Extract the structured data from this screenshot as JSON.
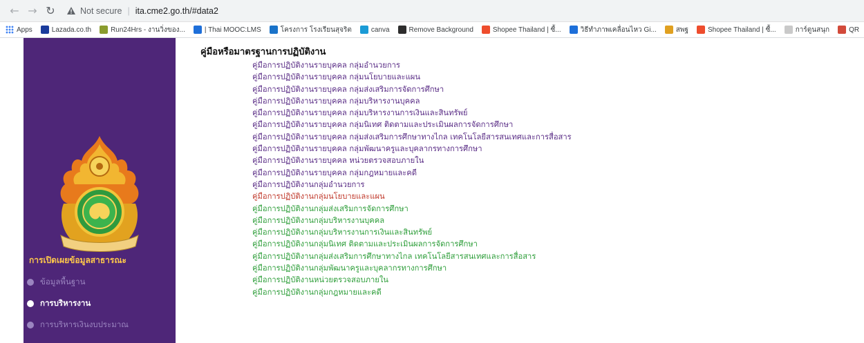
{
  "browser": {
    "security_label": "Not secure",
    "url": "ita.cme2.go.th/#data2",
    "icons": [
      "back-arrow-icon",
      "forward-arrow-icon",
      "reload-icon",
      "warning-triangle-icon"
    ]
  },
  "bookmarks": [
    {
      "label": "Apps",
      "icon": "apps-grid-icon",
      "color": "#4285f4"
    },
    {
      "label": "Lazada.co.th",
      "icon": "lazada-icon",
      "color": "#1a3b9c"
    },
    {
      "label": "Run24Hrs - งานวิ่งของ...",
      "icon": "run-icon",
      "color": "#8a9c2e"
    },
    {
      "label": "| Thai MOOC:LMS",
      "icon": "thaimooc-icon",
      "color": "#1e6fd9"
    },
    {
      "label": "โครงการ โรงเรียนสุจริต",
      "icon": "school-icon",
      "color": "#1a73c9"
    },
    {
      "label": "canva",
      "icon": "canva-icon",
      "color": "#1a9bd6"
    },
    {
      "label": "Remove Background",
      "icon": "removebg-icon",
      "color": "#2d2d2d"
    },
    {
      "label": "Shopee Thailand | ซื้...",
      "icon": "shopee-icon",
      "color": "#ee4d2d"
    },
    {
      "label": "วิธีทำภาพเคลื่อนไหว Gi...",
      "icon": "gif-icon",
      "color": "#1d6fd9"
    },
    {
      "label": "สพฐ",
      "icon": "obec-icon",
      "color": "#e0a020"
    },
    {
      "label": "Shopee Thailand | ซื้...",
      "icon": "shopee-icon",
      "color": "#ee4d2d"
    },
    {
      "label": "การ์ตูนสนุก",
      "icon": "cartoon-icon",
      "color": "#c9c9c9"
    },
    {
      "label": "QR",
      "icon": "qr-icon",
      "color": "#d24a3a"
    }
  ],
  "sidebar": {
    "heading": "การเปิดเผยข้อมูลสาธารณะ",
    "items": [
      {
        "label": "ข้อมูลพื้นฐาน",
        "state": "muted"
      },
      {
        "label": "การบริหารงาน",
        "state": "active"
      },
      {
        "label": "การบริหารเงินงบประมาณ",
        "state": "muted"
      }
    ],
    "colors": {
      "background": "#4e2678",
      "heading": "#ffc94a",
      "muted": "#9b85c0",
      "active": "#ffffff"
    }
  },
  "main": {
    "title": "คู่มือหรือมาตรฐานการปฏิบัติงาน",
    "documents": [
      {
        "label": "คู่มือการปฏิบัติงานรายบุคคล กลุ่มอำนวยการ",
        "color": "purple"
      },
      {
        "label": "คู่มือการปฏิบัติงานรายบุคคล กลุ่มนโยบายและแผน",
        "color": "purple"
      },
      {
        "label": "คู่มือการปฏิบัติงานรายบุคคล กลุ่มส่งเสริมการจัดการศึกษา",
        "color": "purple"
      },
      {
        "label": "คู่มือการปฏิบัติงานรายบุคคล กลุ่มบริหารงานบุคคล",
        "color": "purple"
      },
      {
        "label": "คู่มือการปฏิบัติงานรายบุคคล กลุ่มบริหารงานการเงินและสินทรัพย์",
        "color": "purple"
      },
      {
        "label": "คู่มือการปฏิบัติงานรายบุคคล กลุ่มนิเทศ ติดตามและประเมินผลการจัดการศึกษา",
        "color": "purple"
      },
      {
        "label": "คู่มือการปฏิบัติงานรายบุคคล กลุ่มส่งเสริมการศึกษาทางไกล เทคโนโลยีสารสนเทศและการสื่อสาร",
        "color": "purple"
      },
      {
        "label": "คู่มือการปฏิบัติงานรายบุคคล กลุ่มพัฒนาครูและบุคลากรทางการศึกษา",
        "color": "purple"
      },
      {
        "label": "คู่มือการปฏิบัติงานรายบุคคล หน่วยตรวจสอบภายใน",
        "color": "purple"
      },
      {
        "label": "คู่มือการปฏิบัติงานรายบุคคล กลุ่มกฎหมายและคดี",
        "color": "purple"
      },
      {
        "label": "คู่มือการปฏิบัติงานกลุ่มอำนวยการ",
        "color": "purple"
      },
      {
        "label": "คู่มือการปฏิบัติงานกลุ่มนโยบายและแผน",
        "color": "red"
      },
      {
        "label": "คู่มือการปฏิบัติงานกลุ่มส่งเสริมการจัดการศึกษา",
        "color": "green"
      },
      {
        "label": "คู่มือการปฏิบัติงานกลุ่มบริหารงานบุคคล",
        "color": "green"
      },
      {
        "label": "คู่มือการปฏิบัติงานกลุ่มบริหารงานการเงินและสินทรัพย์",
        "color": "green"
      },
      {
        "label": "คู่มือการปฏิบัติงานกลุ่มนิเทศ ติดตามและประเมินผลการจัดการศึกษา",
        "color": "green"
      },
      {
        "label": "คู่มือการปฏิบัติงานกลุ่มส่งเสริมการศึกษาทางไกล เทคโนโลยีสารสนเทศและการสื่อสาร",
        "color": "green"
      },
      {
        "label": "คู่มือการปฏิบัติงานกลุ่มพัฒนาครูและบุคลากรทางการศึกษา",
        "color": "green"
      },
      {
        "label": "คู่มือการปฏิบัติงานหน่วยตรวจสอบภายใน",
        "color": "green"
      },
      {
        "label": "คู่มือการปฏิบัติงานกลุ่มกฎหมายและคดี",
        "color": "green"
      }
    ],
    "colors": {
      "purple": "#5a2d86",
      "red": "#c0392b",
      "green": "#2e9e3a"
    }
  }
}
